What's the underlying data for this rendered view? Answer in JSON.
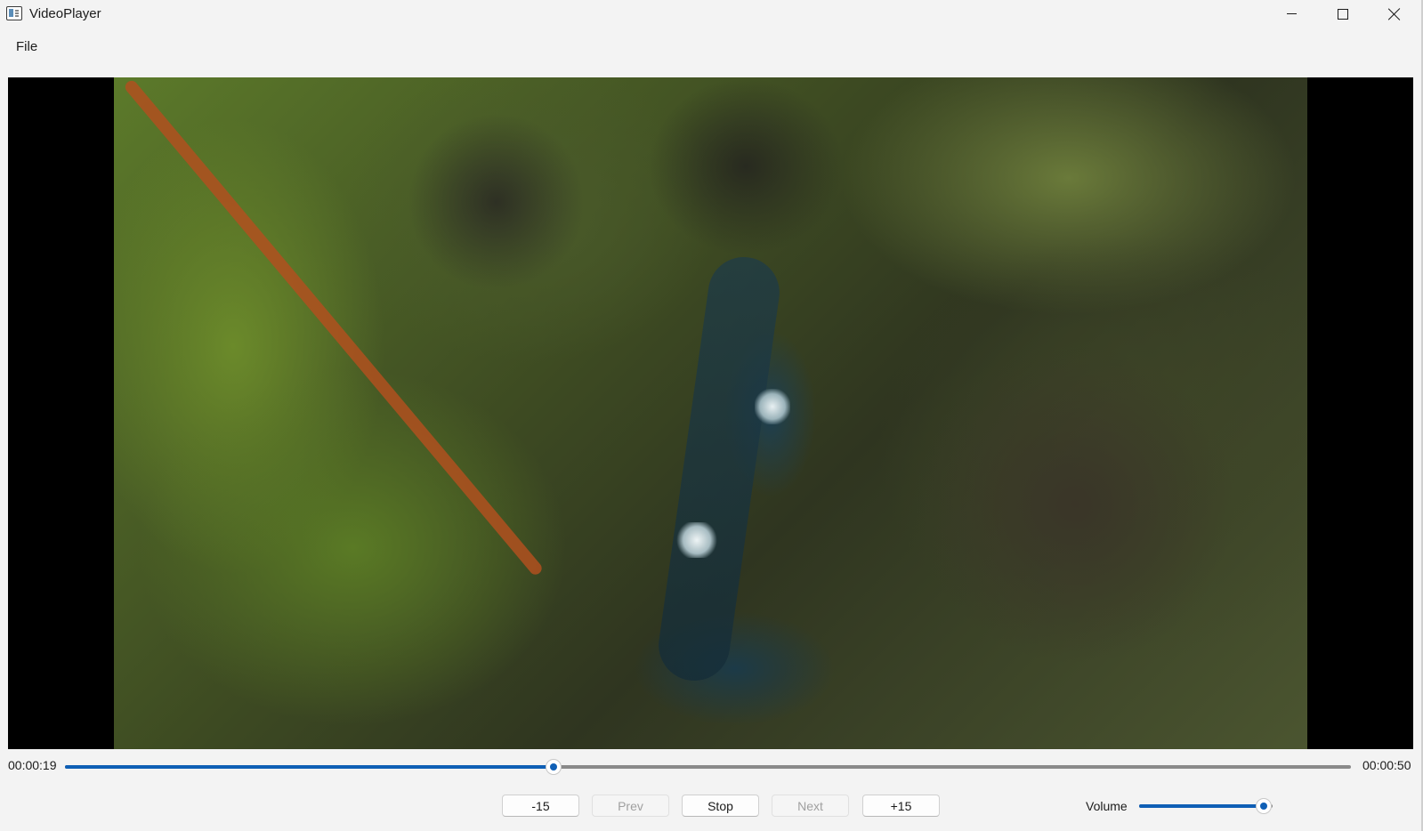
{
  "window": {
    "title": "VideoPlayer",
    "app_icon": "video-app-icon",
    "controls": [
      "minimize-icon",
      "maximize-icon",
      "close-icon"
    ]
  },
  "menu": {
    "items": [
      {
        "label": "File"
      }
    ]
  },
  "video": {
    "description_icon": "video-frame"
  },
  "playback": {
    "current_time": "00:00:19",
    "total_time": "00:00:50",
    "progress": 0.38
  },
  "buttons": {
    "back15": "-15",
    "prev": "Prev",
    "stop": "Stop",
    "next": "Next",
    "fwd15": "+15"
  },
  "volume": {
    "label": "Volume",
    "level": 0.93
  },
  "colors": {
    "accent": "#0f5fb5",
    "background": "#f3f3f3",
    "video_bg": "#000000"
  }
}
